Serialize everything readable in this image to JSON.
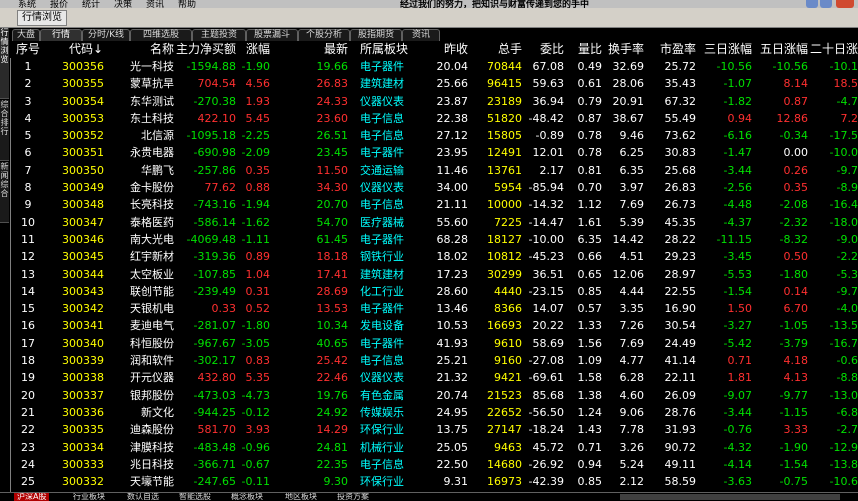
{
  "menu": {
    "items": [
      "系统",
      "报价",
      "统计",
      "决策",
      "资讯",
      "帮助"
    ],
    "marquee": "经过我们的努力，把知识与财富传递到您的手中"
  },
  "toolbar": {
    "view_button": "行情浏览"
  },
  "tabs": [
    "大盘",
    "行情",
    "分时/K线",
    "四维选股",
    "主题投资",
    "股票漏斗",
    "个股分析",
    "股指期货",
    "资讯"
  ],
  "active_tab": 1,
  "side_tabs": [
    "行情浏览",
    "综合排行",
    "新闻综合"
  ],
  "table": {
    "columns": [
      "序号",
      "代码↓",
      "名称",
      "主力净买额",
      "涨幅",
      "最新",
      "所属板块",
      "昨收",
      "总手",
      "委比",
      "量比",
      "换手率",
      "市盈率",
      "三日涨幅",
      "五日涨幅",
      "二十日涨幅"
    ],
    "rows": [
      [
        "1",
        "300356",
        "光一科技",
        "-1594.88",
        "-1.90",
        "19.66",
        "电子器件",
        "20.04",
        "70844",
        "67.08",
        "0.49",
        "32.69",
        "25.72",
        "-10.56",
        "-10.56",
        "-10.1"
      ],
      [
        "2",
        "300355",
        "蒙草抗旱",
        "704.54",
        "4.56",
        "26.83",
        "建筑建材",
        "25.66",
        "96415",
        "59.63",
        "0.61",
        "28.06",
        "35.43",
        "-1.07",
        "8.14",
        "18.5"
      ],
      [
        "3",
        "300354",
        "东华测试",
        "-270.38",
        "1.93",
        "24.33",
        "仪器仪表",
        "23.87",
        "23189",
        "36.94",
        "0.79",
        "20.91",
        "67.32",
        "-1.82",
        "0.87",
        "-4.7"
      ],
      [
        "4",
        "300353",
        "东土科技",
        "422.10",
        "5.45",
        "23.60",
        "电子信息",
        "22.38",
        "51820",
        "-48.42",
        "0.87",
        "38.67",
        "55.49",
        "0.94",
        "12.86",
        "7.2"
      ],
      [
        "5",
        "300352",
        "北信源",
        "-1095.18",
        "-2.25",
        "26.51",
        "电子信息",
        "27.12",
        "15805",
        "-0.89",
        "0.78",
        "9.46",
        "73.62",
        "-6.16",
        "-0.34",
        "-17.5"
      ],
      [
        "6",
        "300351",
        "永贵电器",
        "-690.98",
        "-2.09",
        "23.45",
        "电子器件",
        "23.95",
        "12491",
        "12.01",
        "0.78",
        "6.25",
        "30.83",
        "-1.47",
        "0.00",
        "-10.0"
      ],
      [
        "7",
        "300350",
        "华鹏飞",
        "-257.86",
        "0.35",
        "11.50",
        "交通运输",
        "11.46",
        "13761",
        "2.17",
        "0.81",
        "6.35",
        "25.68",
        "-3.44",
        "0.26",
        "-9.7"
      ],
      [
        "8",
        "300349",
        "金卡股份",
        "77.62",
        "0.88",
        "34.30",
        "仪器仪表",
        "34.00",
        "5954",
        "-85.94",
        "0.70",
        "3.97",
        "26.83",
        "-2.56",
        "0.35",
        "-8.9"
      ],
      [
        "9",
        "300348",
        "长亮科技",
        "-743.16",
        "-1.94",
        "20.70",
        "电子信息",
        "21.11",
        "10000",
        "-14.32",
        "1.12",
        "7.69",
        "26.73",
        "-4.48",
        "-2.08",
        "-16.4"
      ],
      [
        "10",
        "300347",
        "泰格医药",
        "-586.14",
        "-1.62",
        "54.70",
        "医疗器械",
        "55.60",
        "7225",
        "-14.47",
        "1.61",
        "5.39",
        "45.35",
        "-4.37",
        "-2.32",
        "-18.0"
      ],
      [
        "11",
        "300346",
        "南大光电",
        "-4069.48",
        "-1.11",
        "61.45",
        "电子器件",
        "68.28",
        "18127",
        "-10.00",
        "6.35",
        "14.42",
        "28.22",
        "-11.15",
        "-8.32",
        "-9.0"
      ],
      [
        "12",
        "300345",
        "红宇新材",
        "-319.36",
        "0.89",
        "18.18",
        "钢铁行业",
        "18.02",
        "10812",
        "-45.23",
        "0.66",
        "4.51",
        "29.23",
        "-3.45",
        "0.50",
        "-2.2"
      ],
      [
        "13",
        "300344",
        "太空板业",
        "-107.85",
        "1.04",
        "17.41",
        "建筑建材",
        "17.23",
        "30299",
        "36.51",
        "0.65",
        "12.06",
        "28.97",
        "-5.53",
        "-1.80",
        "-5.3"
      ],
      [
        "14",
        "300343",
        "联创节能",
        "-239.49",
        "0.31",
        "28.69",
        "化工行业",
        "28.60",
        "4440",
        "-23.15",
        "0.85",
        "4.44",
        "22.55",
        "-1.54",
        "0.14",
        "-9.7"
      ],
      [
        "15",
        "300342",
        "天银机电",
        "0.33",
        "0.52",
        "13.53",
        "电子器件",
        "13.46",
        "8366",
        "14.07",
        "0.57",
        "3.35",
        "16.90",
        "1.50",
        "6.70",
        "-4.0"
      ],
      [
        "16",
        "300341",
        "麦迪电气",
        "-281.07",
        "-1.80",
        "10.34",
        "发电设备",
        "10.53",
        "16693",
        "20.22",
        "1.33",
        "7.26",
        "30.54",
        "-3.27",
        "-1.05",
        "-13.5"
      ],
      [
        "17",
        "300340",
        "科恒股份",
        "-967.67",
        "-3.05",
        "40.65",
        "电子器件",
        "41.93",
        "9610",
        "58.69",
        "1.56",
        "7.69",
        "24.49",
        "-5.42",
        "-3.79",
        "-16.7"
      ],
      [
        "18",
        "300339",
        "润和软件",
        "-302.17",
        "0.83",
        "25.42",
        "电子信息",
        "25.21",
        "9160",
        "-27.08",
        "1.09",
        "4.77",
        "41.14",
        "0.71",
        "4.18",
        "-0.6"
      ],
      [
        "19",
        "300338",
        "开元仪器",
        "432.80",
        "5.35",
        "22.46",
        "仪器仪表",
        "21.32",
        "9421",
        "-69.61",
        "1.58",
        "6.28",
        "22.11",
        "1.81",
        "4.13",
        "-8.8"
      ],
      [
        "20",
        "300337",
        "银邦股份",
        "-473.03",
        "-4.73",
        "19.76",
        "有色金属",
        "20.74",
        "21523",
        "85.68",
        "1.38",
        "4.60",
        "26.09",
        "-9.07",
        "-9.77",
        "-13.0"
      ],
      [
        "21",
        "300336",
        "新文化",
        "-944.25",
        "-0.12",
        "24.92",
        "传媒娱乐",
        "24.95",
        "22652",
        "-56.50",
        "1.24",
        "9.06",
        "28.76",
        "-3.44",
        "-1.15",
        "-6.8"
      ],
      [
        "22",
        "300335",
        "迪森股份",
        "581.70",
        "3.93",
        "14.29",
        "环保行业",
        "13.75",
        "27147",
        "-18.24",
        "1.43",
        "7.78",
        "31.93",
        "-0.76",
        "3.33",
        "-2.7"
      ],
      [
        "23",
        "300334",
        "津膜科技",
        "-483.48",
        "-0.96",
        "24.81",
        "机械行业",
        "25.05",
        "9463",
        "45.72",
        "0.71",
        "3.26",
        "90.72",
        "-4.32",
        "-1.90",
        "-12.9"
      ],
      [
        "24",
        "300333",
        "兆日科技",
        "-366.71",
        "-0.67",
        "22.35",
        "电子信息",
        "22.50",
        "14680",
        "-26.92",
        "0.94",
        "5.24",
        "49.11",
        "-4.14",
        "-1.54",
        "-13.8"
      ],
      [
        "25",
        "300332",
        "天壕节能",
        "-247.65",
        "-0.11",
        "9.30",
        "环保行业",
        "9.31",
        "16973",
        "-42.39",
        "0.85",
        "2.12",
        "58.59",
        "-3.63",
        "-0.75",
        "-10.6"
      ]
    ]
  },
  "bottom_tabs": [
    "沪深A股",
    "行业板块",
    "数认自选",
    "智能选股",
    "概念板块",
    "地区板块",
    "投资方案"
  ],
  "colors": {
    "up": "#ff3030",
    "down": "#00e000",
    "code": "#ffff00",
    "board": "#00ffff",
    "header": "#ffffff"
  }
}
